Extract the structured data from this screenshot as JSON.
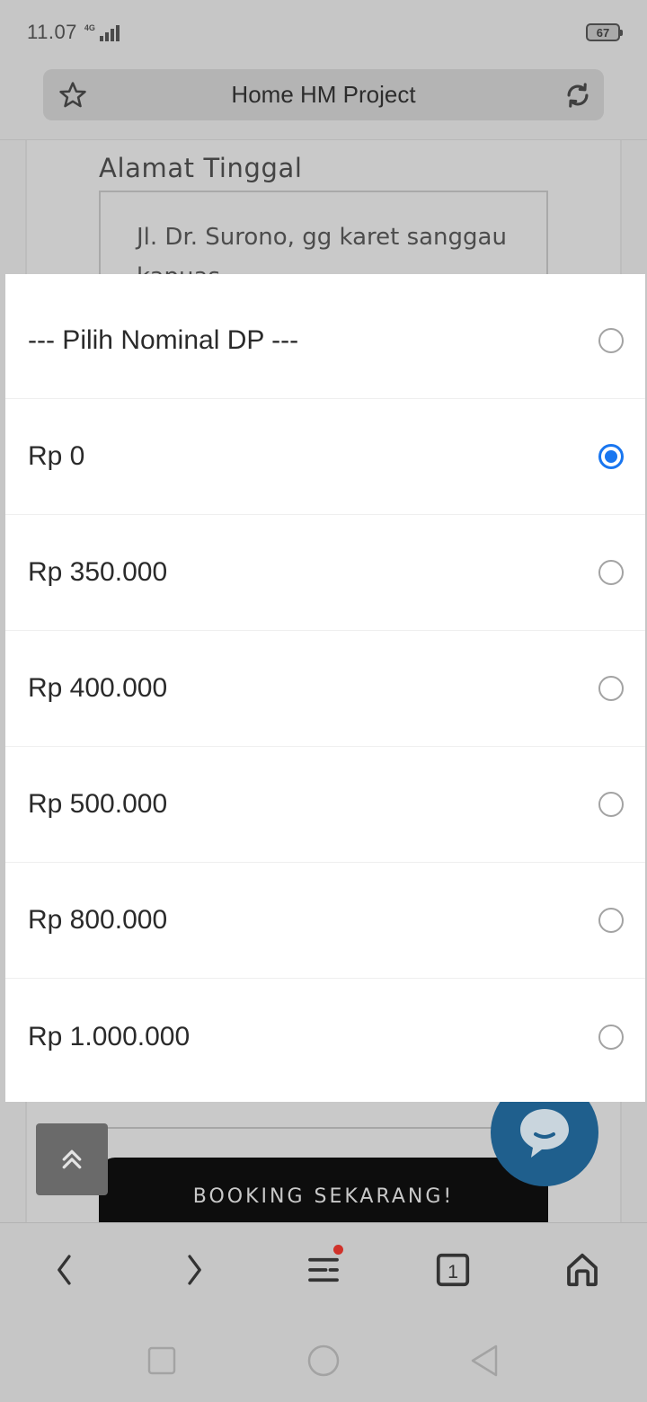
{
  "status_bar": {
    "time": "11.07",
    "network": "4G",
    "battery": "67"
  },
  "url_bar": {
    "title": "Home HM Project",
    "left_icon": "star-icon",
    "right_icon": "refresh-icon"
  },
  "page": {
    "address_label": "Alamat Tinggal",
    "address_value": "Jl. Dr. Surono, gg karet sanggau kapuas",
    "booking_button": "BOOKING SEKARANG!"
  },
  "dialog": {
    "options": [
      {
        "label": "--- Pilih Nominal DP ---",
        "selected": false
      },
      {
        "label": "Rp 0",
        "selected": true
      },
      {
        "label": "Rp 350.000",
        "selected": false
      },
      {
        "label": "Rp 400.000",
        "selected": false
      },
      {
        "label": "Rp 500.000",
        "selected": false
      },
      {
        "label": "Rp 800.000",
        "selected": false
      },
      {
        "label": "Rp 1.000.000",
        "selected": false
      }
    ]
  },
  "browser_nav": {
    "tab_count": "1"
  },
  "colors": {
    "radio_selected": "#1976f0",
    "chat_button": "#1f5f8d",
    "booking_button_bg": "#0d0d0d",
    "notification_dot": "#d0322a"
  }
}
